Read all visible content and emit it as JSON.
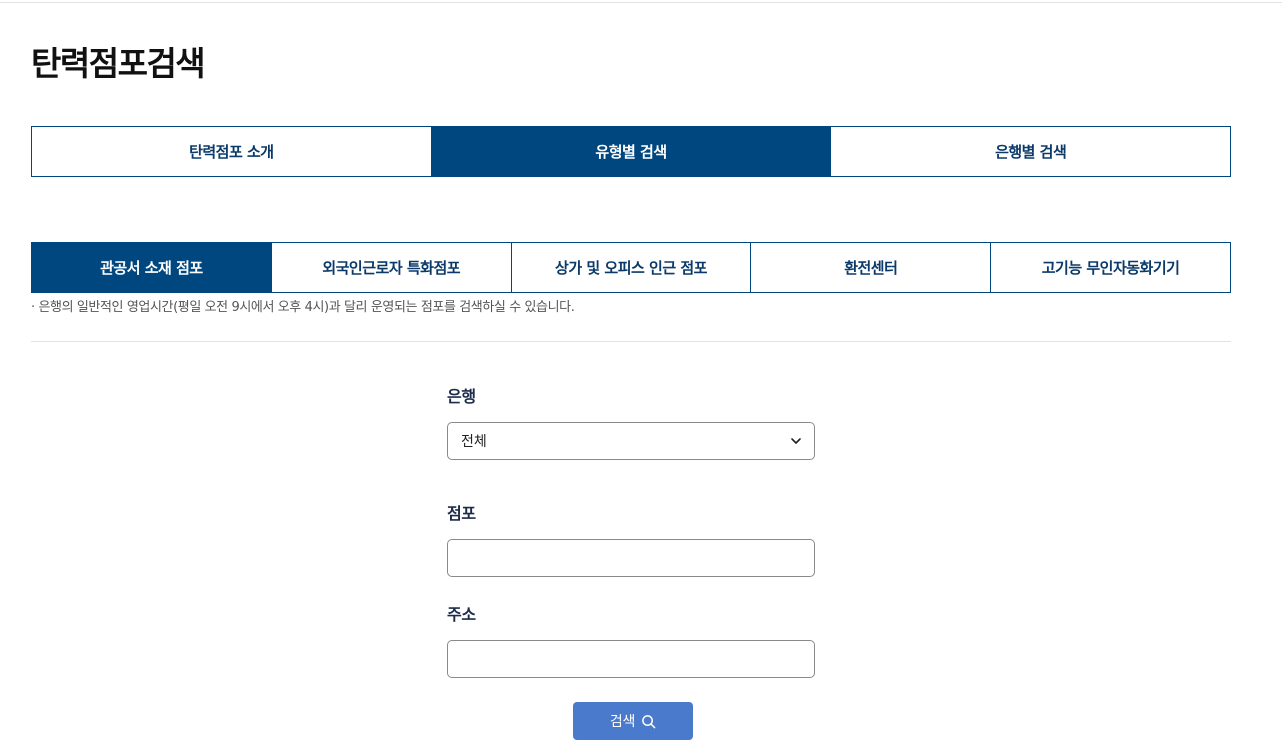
{
  "page": {
    "title": "탄력점포검색"
  },
  "main_tabs": [
    {
      "label": "탄력점포 소개",
      "active": false
    },
    {
      "label": "유형별 검색",
      "active": true
    },
    {
      "label": "은행별 검색",
      "active": false
    }
  ],
  "sub_tabs": [
    {
      "label": "관공서 소재 점포",
      "active": true
    },
    {
      "label": "외국인근로자 특화점포",
      "active": false
    },
    {
      "label": "상가 및 오피스 인근 점포",
      "active": false
    },
    {
      "label": "환전센터",
      "active": false
    },
    {
      "label": "고기능 무인자동화기기",
      "active": false
    }
  ],
  "notice": "· 은행의 일반적인 영업시간(평일 오전 9시에서 오후 4시)과 달리 운영되는 점포를 검색하실 수 있습니다.",
  "form": {
    "bank_label": "은행",
    "bank_selected": "전체",
    "branch_label": "점포",
    "branch_value": "",
    "address_label": "주소",
    "address_value": "",
    "search_button_label": "검색"
  },
  "colors": {
    "primary": "#00467f",
    "button": "#4a7acb",
    "border": "#8a8a8a"
  },
  "icons": {
    "select_arrow": "chevron-down-icon",
    "search": "search-icon"
  }
}
